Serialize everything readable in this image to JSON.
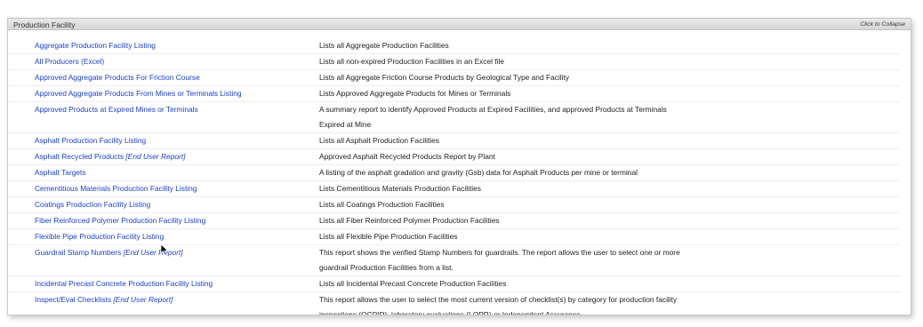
{
  "section": {
    "title": "Production Facility",
    "collapse_label": "Click to Collapse"
  },
  "reports": [
    {
      "name": "Aggregate Production Facility Listing",
      "tag": "",
      "description": "Lists all Aggregate Production Facilities"
    },
    {
      "name": "All Producers (Excel)",
      "tag": "",
      "description": "Lists all non-expired Production Facilities in an Excel file"
    },
    {
      "name": "Approved Aggregate Products For Friction Course",
      "tag": "",
      "description": "Lists all Aggregate Friction Course Products by Geological Type and Facility"
    },
    {
      "name": "Approved Aggregate Products From Mines or Terminals Listing",
      "tag": "",
      "description": "Lists Approved Aggregate Products for Mines or Terminals"
    },
    {
      "name": "Approved Products at Expired Mines or Terminals",
      "tag": "",
      "description": "A summary report to identify Approved Products at Expired Facilities, and approved Products at Terminals Expired at Mine"
    },
    {
      "name": "Asphalt Production Facility Listing",
      "tag": "",
      "description": "Lists all Asphalt Production Facilities"
    },
    {
      "name": "Asphalt Recycled Products",
      "tag": "[End User Report]",
      "description": "Approved Asphalt Recycled Products Report by Plant"
    },
    {
      "name": "Asphalt Targets",
      "tag": "",
      "description": "A listing of the asphalt gradation and gravity (Gsb) data for Asphalt Products per mine or terminal"
    },
    {
      "name": "Cementitious Materials Production Facility Listing",
      "tag": "",
      "description": "Lists Cementitious Materials Production Facilities"
    },
    {
      "name": "Coatings Production Facility Listing",
      "tag": "",
      "description": "Lists all Coatings Production Facilities"
    },
    {
      "name": "Fiber Reinforced Polymer Production Facility Listing",
      "tag": "",
      "description": "Lists all Fiber Reinforced Polymer Production Facilities"
    },
    {
      "name": "Flexible Pipe Production Facility Listing",
      "tag": "",
      "description": "Lists all Flexible Pipe Production Facilities"
    },
    {
      "name": "Guardrail Stamp Numbers",
      "tag": "[End User Report]",
      "description": "This report shows the verified Stamp Numbers for guardrails. The report allows the user to select one or more guardrail Production Facilities from a list."
    },
    {
      "name": "Incidental Precast Concrete Production Facility Listing",
      "tag": "",
      "description": "Lists all Incidental Precast Concrete Production Facilities"
    },
    {
      "name": "Inspect/Eval Checklists",
      "tag": "[End User Report]",
      "description": "This report allows the user to select the most current version of checklist(s) by category for production facility inspections (QCPIR), laboratory evaluations (LQPR) or Independent Assurance"
    }
  ],
  "colors": {
    "link": "#1a3fcf",
    "header_bg": "#dcdcdc"
  }
}
